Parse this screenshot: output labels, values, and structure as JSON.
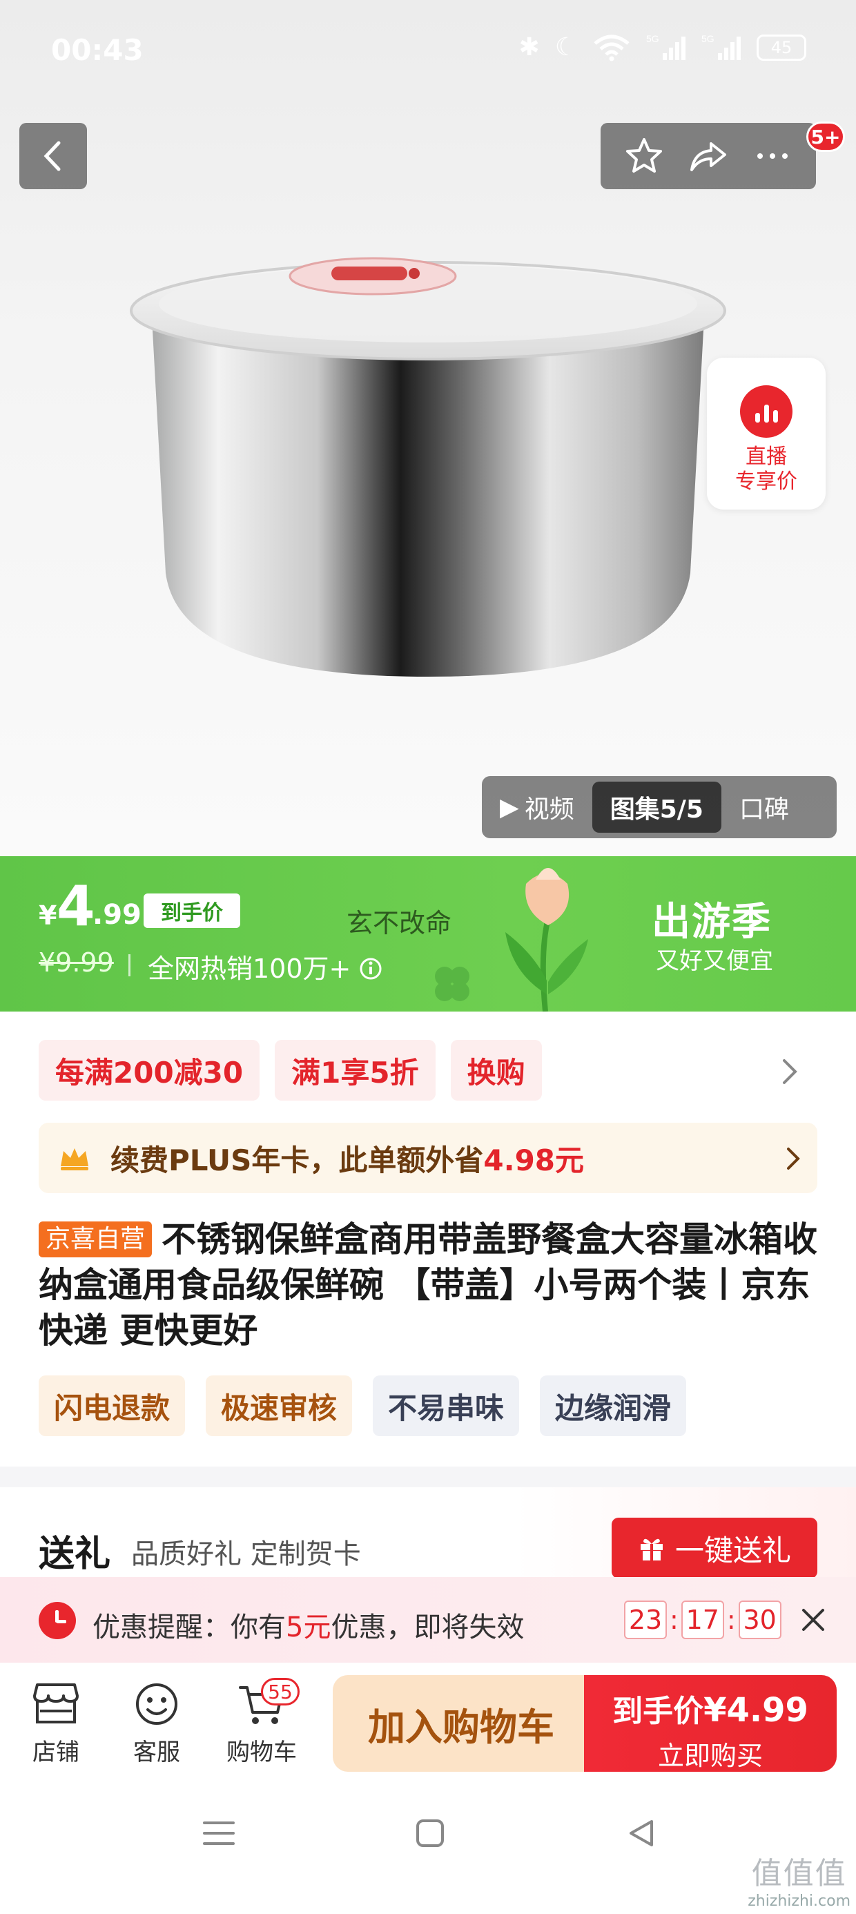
{
  "status_bar": {
    "time": "00:43",
    "battery": "45",
    "signal1": "5G",
    "signal2": "5G"
  },
  "gallery": {
    "video_label": "视频",
    "images_label": "图集5/5",
    "review_label": "口碑",
    "message_badge": "5+"
  },
  "live": {
    "line1": "直播",
    "line2": "专享价"
  },
  "price": {
    "currency": "¥",
    "integer": "4",
    "decimal": ".99",
    "final_tag": "到手价",
    "original": "¥9.99",
    "hot_sales": "全网热销100万+",
    "info_icon": "info-icon",
    "slogan": "玄不改命",
    "season_title": "出游季",
    "season_sub": "又好又便宜",
    "banner_color": "#64c84b"
  },
  "promos": [
    "每满200减30",
    "满1享5折",
    "换购"
  ],
  "plus": {
    "text_prefix": "续费PLUS年卡，此单额外省",
    "amount": "4.98元"
  },
  "product": {
    "seller_tag": "京喜自营",
    "title": "不锈钢保鲜盒商用带盖野餐盒大容量冰箱收纳盒通用食品级保鲜碗 【带盖】小号两个装丨京东快递 更快更好"
  },
  "features": [
    "闪电退款",
    "极速审核",
    "不易串味",
    "边缘润滑"
  ],
  "gift": {
    "heading": "送礼",
    "sub": "品质好礼 定制贺卡",
    "button": "一键送礼"
  },
  "reminder": {
    "prefix": "优惠提醒：你有",
    "amount": "5元",
    "suffix": "优惠，即将失效",
    "hours": "23",
    "minutes": "17",
    "seconds": "30"
  },
  "bottom_bar": {
    "store": "店铺",
    "service": "客服",
    "cart": "购物车",
    "cart_count": "55",
    "add_to_cart": "加入购物车",
    "buy_price_label": "到手价",
    "buy_price": "¥4.99",
    "buy_now": "立即购买"
  },
  "watermark": {
    "brand": "值值值",
    "site": "zhizhizhi.com"
  },
  "colors": {
    "accent_red": "#e8262d",
    "banner_green": "#64c84b",
    "cart_bg": "#fce3c7"
  }
}
